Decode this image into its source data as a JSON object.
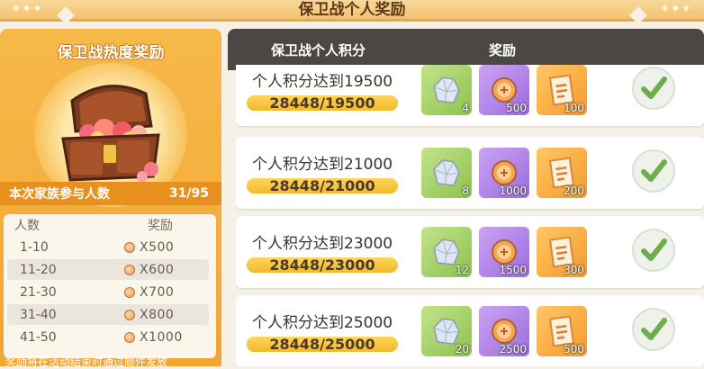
{
  "page_title": "保卫战个人奖励",
  "left_panel": {
    "title": "保卫战热度奖励",
    "participants_label": "本次家族参与人数",
    "participants_value": "31/95",
    "tier_headers": {
      "count": "人数",
      "reward": "奖励"
    },
    "tiers": [
      {
        "range": "1-10",
        "amount": "X500"
      },
      {
        "range": "11-20",
        "amount": "X600"
      },
      {
        "range": "21-30",
        "amount": "X700"
      },
      {
        "range": "31-40",
        "amount": "X800"
      },
      {
        "range": "41-50",
        "amount": "X1000"
      }
    ],
    "notice": "奖励将在活动结束时通过邮件发放"
  },
  "table": {
    "headers": {
      "score": "保卫战个人积分",
      "rewards": "奖励"
    },
    "rows": [
      {
        "requirement": "个人积分达到19500",
        "progress_text": "28448/19500",
        "progress": 1.0,
        "rewards": [
          "4",
          "500",
          "100"
        ],
        "claimed": true
      },
      {
        "requirement": "个人积分达到21000",
        "progress_text": "28448/21000",
        "progress": 1.0,
        "rewards": [
          "8",
          "1000",
          "200"
        ],
        "claimed": true
      },
      {
        "requirement": "个人积分达到23000",
        "progress_text": "28448/23000",
        "progress": 1.0,
        "rewards": [
          "12",
          "1500",
          "300"
        ],
        "claimed": true
      },
      {
        "requirement": "个人积分达到25000",
        "progress_text": "28448/25000",
        "progress": 1.0,
        "rewards": [
          "20",
          "2500",
          "500"
        ],
        "claimed": true
      }
    ]
  },
  "icons": {
    "reward_types": [
      "crystal-icon",
      "coin-icon",
      "ticket-icon"
    ],
    "claimed": "checkmark-icon"
  },
  "colors": {
    "accent_orange": "#f2a533",
    "header_dark": "#4a4744",
    "check_green": "#6cae4d"
  }
}
